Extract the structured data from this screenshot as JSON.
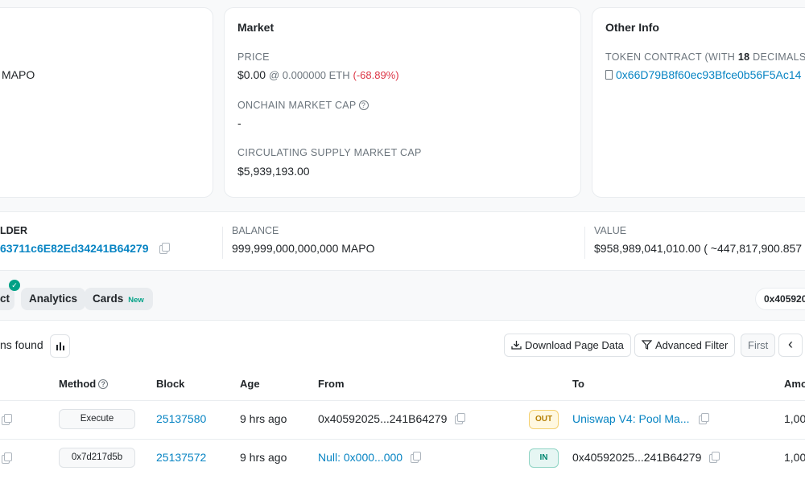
{
  "overview": {
    "max_supply_unit": "MAPO"
  },
  "market": {
    "title": "Market",
    "price_label": "PRICE",
    "price_value": "$0.00",
    "price_eth": "@ 0.000000 ETH",
    "price_change": "(-68.89%)",
    "onchain_cap_label": "ONCHAIN MARKET CAP",
    "onchain_cap_value": "-",
    "circ_cap_label": "CIRCULATING SUPPLY MARKET CAP",
    "circ_cap_value": "$5,939,193.00"
  },
  "other_info": {
    "title": "Other Info",
    "contract_label_prefix": "TOKEN CONTRACT (WITH ",
    "contract_decimals": "18",
    "contract_label_suffix": " DECIMALS)",
    "contract_address": "0x66D79B8f60ec93Bfce0b56F5Ac14"
  },
  "holder_strip": {
    "holder_label": "LDER",
    "holder_address": "63711c6E82Ed34241B64279",
    "balance_label": "BALANCE",
    "balance_value": "999,999,000,000,000 MAPO",
    "value_label": "VALUE",
    "value_value": "$958,989,041,010.00 ( ~447,817,900.857"
  },
  "tabs": {
    "contract_partial": "ct",
    "analytics": "Analytics",
    "cards": "Cards",
    "cards_badge": "New",
    "filter_address": "0x405920"
  },
  "toolbar": {
    "found_text": "ns found",
    "download": "Download Page Data",
    "advanced_filter": "Advanced Filter",
    "first": "First",
    "prev": "‹"
  },
  "table": {
    "headers": {
      "method": "Method",
      "block": "Block",
      "age": "Age",
      "from": "From",
      "to": "To",
      "amount": "Amo"
    },
    "rows": [
      {
        "method": "Execute",
        "block": "25137580",
        "age": "9 hrs ago",
        "from": "0x40592025...241B64279",
        "direction": "OUT",
        "to": "Uniswap V4: Pool Ma...",
        "amount": "1,00"
      },
      {
        "method": "0x7d217d5b",
        "block": "25137572",
        "age": "9 hrs ago",
        "from": "Null: 0x000...000",
        "direction": "IN",
        "to": "0x40592025...241B64279",
        "amount": "1,00"
      }
    ]
  },
  "colors": {
    "link": "#0784c3",
    "negative": "#dc3545",
    "accent_green": "#00a186"
  }
}
